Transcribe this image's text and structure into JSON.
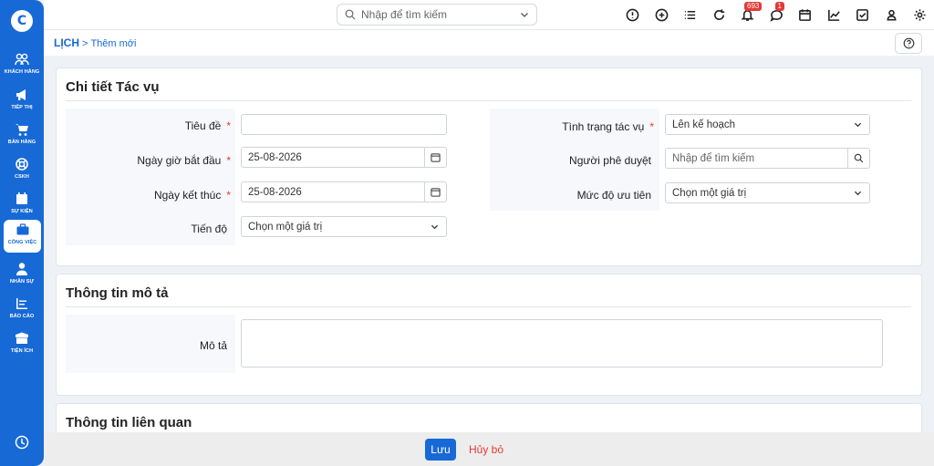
{
  "app": {
    "logo_letter": "C"
  },
  "sidebar": {
    "items": [
      {
        "label": "KHÁCH HÀNG",
        "icon": "users-icon"
      },
      {
        "label": "TIẾP THỊ",
        "icon": "megaphone-icon"
      },
      {
        "label": "BÁN HÀNG",
        "icon": "cart-icon"
      },
      {
        "label": "CSKH",
        "icon": "lifebuoy-icon"
      },
      {
        "label": "SỰ KIỆN",
        "icon": "calendar-icon"
      },
      {
        "label": "CÔNG VIỆC",
        "icon": "briefcase-icon",
        "active": true
      },
      {
        "label": "NHÂN SỰ",
        "icon": "person-icon"
      },
      {
        "label": "BÁO CÁO",
        "icon": "report-icon"
      },
      {
        "label": "TIỆN ÍCH",
        "icon": "box-icon"
      }
    ]
  },
  "topbar": {
    "search_placeholder": "Nhập để tìm kiếm",
    "notifications_count": "693",
    "messages_count": "1"
  },
  "breadcrumb": {
    "root": "LỊCH",
    "separator": ">",
    "current": "Thêm mới"
  },
  "task_details": {
    "title": "Chi tiết Tác vụ",
    "fields": {
      "title_label": "Tiêu đề",
      "title_value": "",
      "start_label": "Ngày giờ bắt đầu",
      "start_value": "25-08-2026",
      "end_label": "Ngày kết thúc",
      "end_value": "25-08-2026",
      "progress_label": "Tiến độ",
      "progress_value": "Chọn một giá trị",
      "status_label": "Tình trạng tác vụ",
      "status_value": "Lên kế hoạch",
      "approver_label": "Người phê duyệt",
      "approver_placeholder": "Nhập để tìm kiếm",
      "priority_label": "Mức độ ưu tiên",
      "priority_value": "Chọn một giá trị"
    },
    "required_mark": "*"
  },
  "description": {
    "title": "Thông tin mô tả",
    "label": "Mô tả",
    "value": ""
  },
  "related": {
    "title": "Thông tin liên quan"
  },
  "footer": {
    "save_label": "Lưu",
    "cancel_label": "Hủy bỏ"
  },
  "colors": {
    "primary": "#1769d6",
    "danger": "#e53935",
    "panel": "#f6f8fb"
  }
}
